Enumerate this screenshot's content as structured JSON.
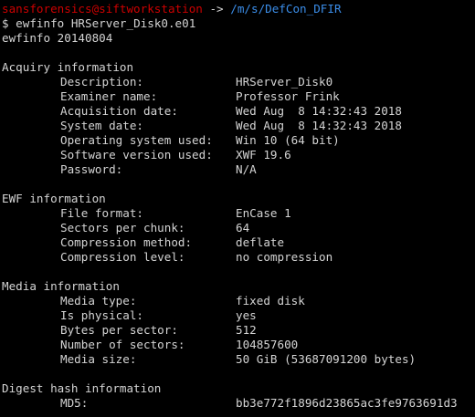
{
  "prompt": {
    "user_host": "sansforensics@siftworkstation",
    "arrow": " -> ",
    "path": "/m/s/DefCon_DFIR",
    "dollar": "$ ",
    "command": "ewfinfo HRServer_Disk0.e01"
  },
  "version_line": "ewfinfo 20140804",
  "sections": {
    "acquiry": {
      "title": "Acquiry information",
      "rows": [
        {
          "key": "Description:",
          "value": "HRServer_Disk0"
        },
        {
          "key": "Examiner name:",
          "value": "Professor Frink"
        },
        {
          "key": "Acquisition date:",
          "value": "Wed Aug  8 14:32:43 2018"
        },
        {
          "key": "System date:",
          "value": "Wed Aug  8 14:32:43 2018"
        },
        {
          "key": "Operating system used:",
          "value": "Win 10 (64 bit)"
        },
        {
          "key": "Software version used:",
          "value": "XWF 19.6"
        },
        {
          "key": "Password:",
          "value": "N/A"
        }
      ]
    },
    "ewf": {
      "title": "EWF information",
      "rows": [
        {
          "key": "File format:",
          "value": "EnCase 1"
        },
        {
          "key": "Sectors per chunk:",
          "value": "64"
        },
        {
          "key": "Compression method:",
          "value": "deflate"
        },
        {
          "key": "Compression level:",
          "value": "no compression"
        }
      ]
    },
    "media": {
      "title": "Media information",
      "rows": [
        {
          "key": "Media type:",
          "value": "fixed disk"
        },
        {
          "key": "Is physical:",
          "value": "yes"
        },
        {
          "key": "Bytes per sector:",
          "value": "512"
        },
        {
          "key": "Number of sectors:",
          "value": "104857600"
        },
        {
          "key": "Media size:",
          "value": "50 GiB (53687091200 bytes)"
        }
      ]
    },
    "digest": {
      "title": "Digest hash information",
      "rows": [
        {
          "key": "MD5:",
          "value": "bb3e772f1896d23865ac3fe9763691d3"
        }
      ]
    }
  },
  "colors": {
    "background": "#000000",
    "text": "#d4d4d4",
    "user_host": "#cc0000",
    "path": "#3b8eea"
  }
}
